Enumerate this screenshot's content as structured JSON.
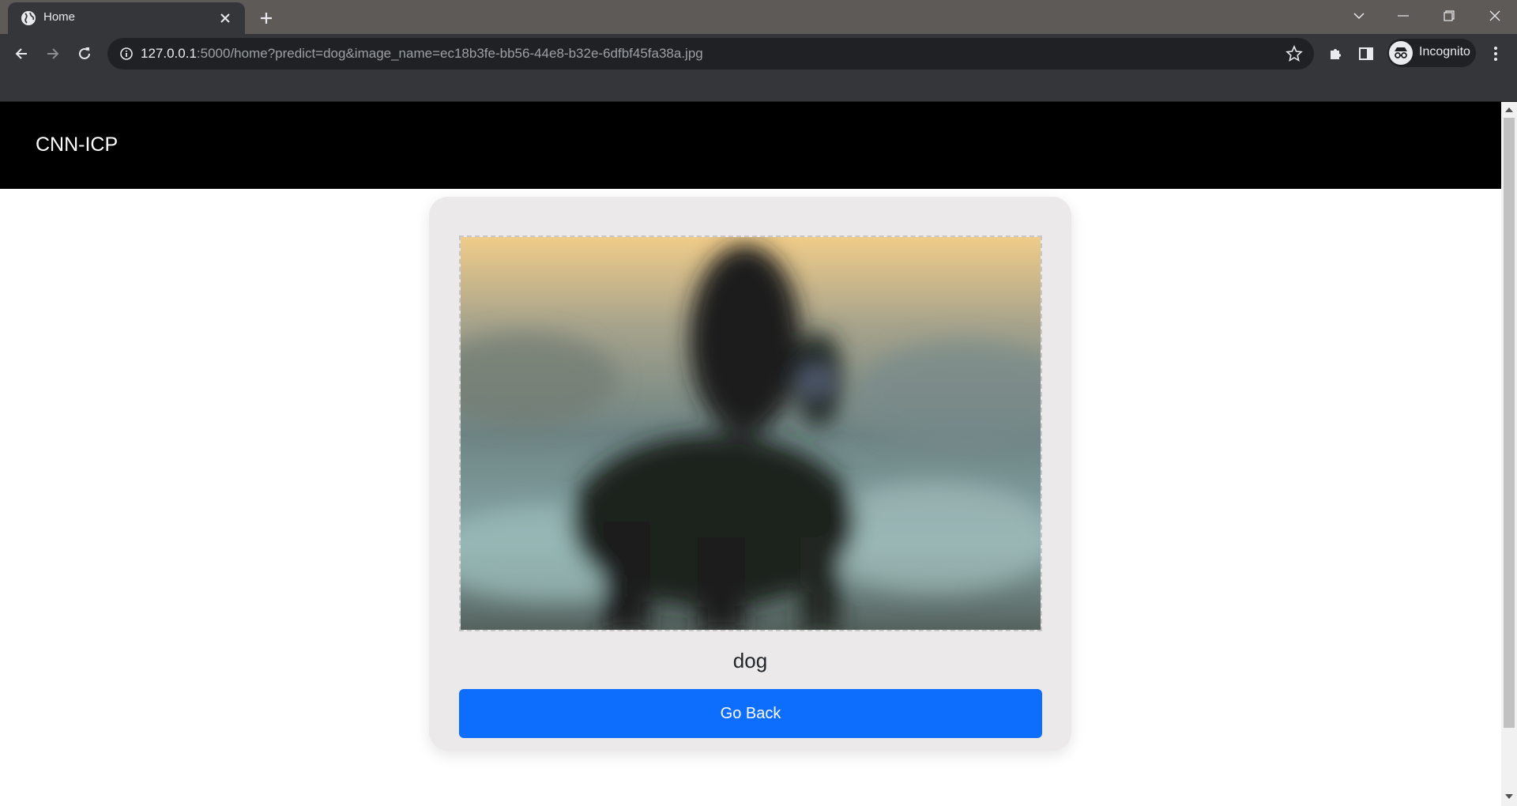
{
  "browser": {
    "tab_title": "Home",
    "url_host": "127.0.0.1",
    "url_rest": ":5000/home?predict=dog&image_name=ec18b3fe-bb56-44e8-b32e-6dfbf45fa38a.jpg",
    "profile_label": "Incognito",
    "icons": [
      "globe-icon",
      "close-icon",
      "plus-icon",
      "chevron-down-icon",
      "minimize-icon",
      "restore-icon",
      "back-icon",
      "forward-icon",
      "reload-icon",
      "info-icon",
      "star-icon",
      "puzzle-icon",
      "sidepanel-icon",
      "incognito-icon",
      "kebab-menu-icon"
    ]
  },
  "page": {
    "brand": "CNN-ICP",
    "prediction_label": "dog",
    "go_back_label": "Go Back",
    "image_alt": "uploaded image of a dog (blurred)"
  },
  "colors": {
    "navbar_bg": "#000000",
    "card_bg": "#ebe9ea",
    "button_bg": "#0d6efd",
    "chrome_dark": "#35363a"
  }
}
